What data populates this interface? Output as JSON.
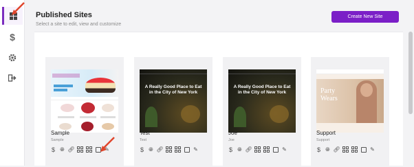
{
  "header": {
    "title": "Published Sites",
    "subtitle": "Select a site to edit, view and customize",
    "create_label": "Create New Site"
  },
  "sidebar": {
    "items": [
      {
        "icon": "dashboard-icon",
        "glyph": "▦",
        "active": true
      },
      {
        "icon": "dollar-icon",
        "glyph": "$",
        "active": false
      },
      {
        "icon": "gear-icon",
        "glyph": "⚙",
        "active": false
      },
      {
        "icon": "logout-icon",
        "glyph": "⇥",
        "active": false
      }
    ]
  },
  "sites": [
    {
      "name": "Sample",
      "sub": "Sample",
      "thumb_headline": ""
    },
    {
      "name": "Test",
      "sub": "Test",
      "thumb_headline": "A Really Good Place to Eat in the City of New York"
    },
    {
      "name": "Joe",
      "sub": "Joe",
      "thumb_headline": "A Really Good Place to Eat in the City of New York"
    },
    {
      "name": "Support",
      "sub": "Support",
      "thumb_headline": "Party Wears"
    }
  ],
  "card_actions": [
    "dollar-icon",
    "globe-icon",
    "link-icon",
    "grid-icon",
    "layout-icon",
    "user-icon",
    "edit-icon"
  ],
  "colors": {
    "accent": "#7b1fc7",
    "annotation_arrow": "#e0452b"
  }
}
